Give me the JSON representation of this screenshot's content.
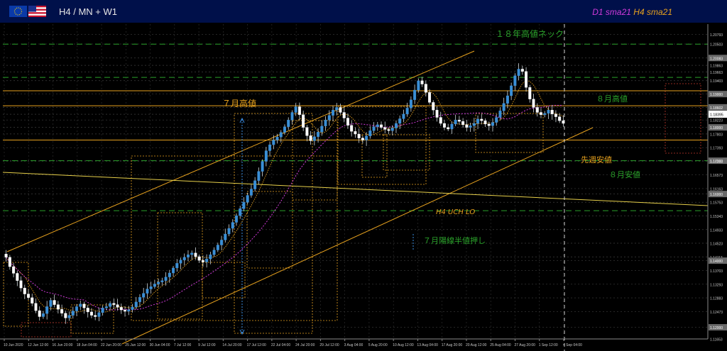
{
  "window": {
    "title": "H4 / MN + W1"
  },
  "legend": {
    "d1": "D1 sma21",
    "h4": "H4 sma21",
    "d1_color": "#d23adb",
    "h4_color": "#e6a11e"
  },
  "chart_data": {
    "type": "candlestick",
    "symbol": "EUR/USD",
    "timeframe": "H4",
    "ylim": [
      1.1165,
      1.211
    ],
    "price_ticks": [
      "1.20793",
      "1.20503",
      "1.20083",
      "1.19863",
      "1.19663",
      "1.19403",
      "1.19000",
      "1.18602",
      "1.18395",
      "1.18223",
      "1.18000",
      "1.17803",
      "1.17393",
      "1.17000",
      "1.16983",
      "1.16573",
      "1.16163",
      "1.16000",
      "1.15753",
      "1.15343",
      "1.14933",
      "1.14523",
      "1.14113",
      "1.14000",
      "1.13703",
      "1.13293",
      "1.12883",
      "1.12473",
      "1.12000",
      "1.11653"
    ],
    "x_ticks": [
      "10 Jun 2020",
      "12 Jun 12:00",
      "16 Jun 20:00",
      "18 Jun 04:00",
      "22 Jun 20:00",
      "25 Jun 12:00",
      "30 Jun 04:00",
      "7 Jul 12:00",
      "9 Jul 12:00",
      "14 Jul 20:00",
      "17 Jul 12:00",
      "22 Jul 04:00",
      "24 Jul 20:00",
      "29 Jul 12:00",
      "3 Aug 04:00",
      "5 Aug 20:00",
      "10 Aug 12:00",
      "13 Aug 04:00",
      "17 Aug 20:00",
      "20 Aug 12:00",
      "25 Aug 04:00",
      "27 Aug 20:00",
      "1 Sep 12:00",
      "4 Sep 04:00"
    ],
    "current_price": "1.18395",
    "close_series": [
      1.141,
      1.1382,
      1.1362,
      1.134,
      1.1318,
      1.13,
      1.1289,
      1.1272,
      1.125,
      1.1232,
      1.1241,
      1.1262,
      1.1281,
      1.1268,
      1.1254,
      1.1242,
      1.1228,
      1.1236,
      1.1249,
      1.1262,
      1.127,
      1.1258,
      1.1246,
      1.1236,
      1.1232,
      1.1244,
      1.1258,
      1.1262,
      1.1272,
      1.1268,
      1.126,
      1.1252,
      1.1248,
      1.1253,
      1.1261,
      1.1276,
      1.129,
      1.1302,
      1.1315,
      1.1322,
      1.133,
      1.1336,
      1.134,
      1.1351,
      1.1363,
      1.1378,
      1.1392,
      1.1402,
      1.141,
      1.1418,
      1.1423,
      1.1412,
      1.1401,
      1.1396,
      1.1405,
      1.1418,
      1.1432,
      1.1447,
      1.1462,
      1.148,
      1.1497,
      1.1515,
      1.1535,
      1.1556,
      1.1575,
      1.1596,
      1.1615,
      1.164,
      1.1668,
      1.1698,
      1.173,
      1.1748,
      1.1762,
      1.1771,
      1.1785,
      1.1802,
      1.1822,
      1.1845,
      1.1862,
      1.1838,
      1.18,
      1.1775,
      1.176,
      1.1772,
      1.1786,
      1.1804,
      1.1822,
      1.1836,
      1.1852,
      1.186,
      1.1845,
      1.1828,
      1.1806,
      1.1788,
      1.178,
      1.1768,
      1.1762,
      1.1774,
      1.179,
      1.1802,
      1.1808,
      1.18,
      1.1794,
      1.179,
      1.1798,
      1.1812,
      1.1826,
      1.184,
      1.1858,
      1.1883,
      1.1912,
      1.194,
      1.193,
      1.1905,
      1.1875,
      1.1852,
      1.183,
      1.1812,
      1.18,
      1.1795,
      1.181,
      1.1822,
      1.1818,
      1.1808,
      1.18,
      1.1805,
      1.1812,
      1.1825,
      1.182,
      1.181,
      1.1805,
      1.1815,
      1.183,
      1.185,
      1.1872,
      1.1895,
      1.1925,
      1.1955,
      1.1975,
      1.1968,
      1.192,
      1.1885,
      1.186,
      1.1845,
      1.1838,
      1.1842,
      1.1852,
      1.184,
      1.1832,
      1.182,
      1.1812
    ],
    "annotations": [
      {
        "text": "１８年高値ネック",
        "color": "#2aa12a"
      },
      {
        "text": "８月高値",
        "color": "#2aa12a"
      },
      {
        "text": "７月高値",
        "color": "#e6a11e"
      },
      {
        "text": "先週安値",
        "color": "#e6a11e"
      },
      {
        "text": "８月安値",
        "color": "#2aa12a"
      },
      {
        "text": "H4 UCH LO",
        "color": "#e6a11e"
      },
      {
        "text": "７月陽線半値押し",
        "color": "#2aa12a"
      }
    ],
    "horizontal_levels": [
      {
        "price": 1.205,
        "color": "#2aa12a",
        "style": "dashed"
      },
      {
        "price": 1.195,
        "color": "#2aa12a",
        "style": "dashed"
      },
      {
        "price": 1.17,
        "color": "#2aa12a",
        "style": "dashed"
      },
      {
        "price": 1.155,
        "color": "#2aa12a",
        "style": "dashed"
      },
      {
        "price": 1.191,
        "color": "#e6a11e",
        "style": "solid"
      },
      {
        "price": 1.1865,
        "color": "#e6a11e",
        "style": "solid"
      },
      {
        "price": 1.1762,
        "color": "#e6a11e",
        "style": "solid"
      }
    ],
    "grid": true
  }
}
